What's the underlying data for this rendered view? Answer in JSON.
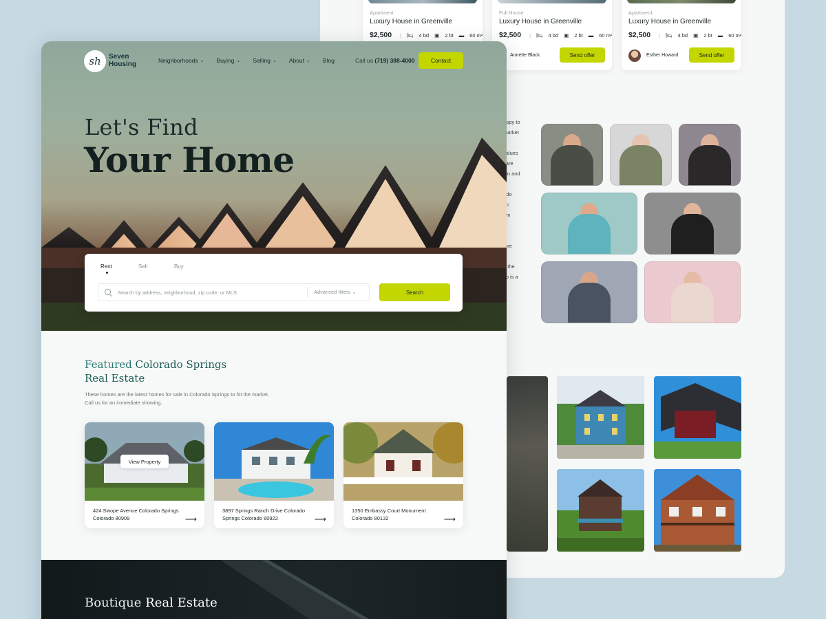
{
  "brand": {
    "name": "Seven Housing",
    "monogram": "sh"
  },
  "nav": {
    "items": [
      {
        "label": "Neighborhoods",
        "has_dropdown": true
      },
      {
        "label": "Buying",
        "has_dropdown": true
      },
      {
        "label": "Selling",
        "has_dropdown": true
      },
      {
        "label": "About",
        "has_dropdown": true
      },
      {
        "label": "Blog",
        "has_dropdown": false
      }
    ],
    "call_label": "Call us",
    "phone": "(719) 388-4000",
    "contact_label": "Contact"
  },
  "hero": {
    "line1": "Let's Find",
    "line2": "Your Home"
  },
  "search": {
    "tabs": [
      "Rent",
      "Sell",
      "Buy"
    ],
    "active_tab": "Rent",
    "placeholder": "Search by address, neighborhood, zip code, or MLS",
    "value": "",
    "advanced_filters_label": "Advanced filters",
    "button_label": "Search"
  },
  "featured": {
    "title_part1": "Featured",
    "title_part2": "Colorado Springs",
    "title_line2": "Real Estate",
    "description_line1": "These homes are the latest homes for sale in Colorado Springs to hit the market.",
    "description_line2": "Call us for an immediate showing.",
    "view_property_label": "View Property",
    "properties": [
      {
        "address": "424 Swope Avenue Colorado Springs Colorado 80909"
      },
      {
        "address": "3897 Springs Ranch Drive Colorado Springs Colorado 80922"
      },
      {
        "address": "1350 Embassy Court Monument Colorado 80132"
      }
    ]
  },
  "boutique": {
    "title_part1": "Boutique",
    "title_part2": "Real Estate"
  },
  "listings": [
    {
      "type": "Apartment",
      "title": "Luxury House in Greenville",
      "price": "$2,500",
      "beds": "4 bd",
      "baths": "2 bt",
      "area": "60 m²",
      "agent": "",
      "offer_label": ""
    },
    {
      "type": "Full House",
      "title": "Luxury House in Greenville",
      "price": "$2,500",
      "beds": "4 bd",
      "baths": "2 bt",
      "area": "60 m²",
      "agent": "Annette Black",
      "offer_label": "Send offer"
    },
    {
      "type": "Apartment",
      "title": "Luxury House in Greenville",
      "price": "$2,500",
      "beds": "4 bd",
      "baths": "2 bt",
      "area": "60 m²",
      "agent": "Esther Howard",
      "offer_label": "Send offer"
    }
  ],
  "about_fragments": [
    "appy to",
    "market",
    "",
    "values",
    "care",
    "ion and",
    "",
    "ado",
    "ith",
    "em",
    "t",
    "",
    "fore",
    "",
    "o the",
    "so is a"
  ],
  "colors": {
    "accent": "#c3d600",
    "heading_teal": "#2a7a72",
    "dark_band": "#12191b",
    "page_bg": "#f7f8f8",
    "canvas_bg": "#c7d9e2"
  },
  "icons": [
    "search-icon",
    "chevron-down-icon",
    "arrow-right-icon",
    "bed-icon",
    "bath-icon",
    "area-icon"
  ]
}
